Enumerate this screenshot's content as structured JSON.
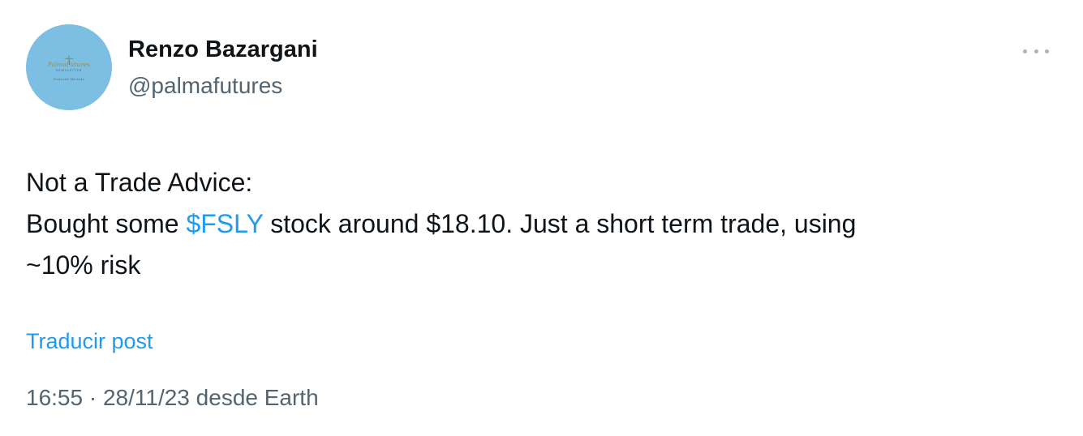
{
  "author": {
    "display_name": "Renzo Bazargani",
    "handle": "@palmafutures",
    "avatar": {
      "logo_title": "PalmaFutures",
      "logo_subtitle": "NEWSLETTER",
      "logo_tagline": "Financial Markets",
      "background_color": "#7cbfe2"
    }
  },
  "menu": {
    "icon": "more-horizontal-icon"
  },
  "tweet": {
    "line1": "Not a Trade Advice:",
    "line2_prefix": "Bought some ",
    "cashtag": "$FSLY",
    "line2_suffix": " stock around $18.10. Just a short term trade, using",
    "line3": "~10% risk"
  },
  "translate_label": "Traducir post",
  "meta": {
    "time": "16:55",
    "separator": " · ",
    "date": "28/11/23",
    "source": " desde Earth"
  },
  "colors": {
    "link": "#1d9bf0",
    "text": "#0f1419",
    "secondary": "#536471"
  }
}
